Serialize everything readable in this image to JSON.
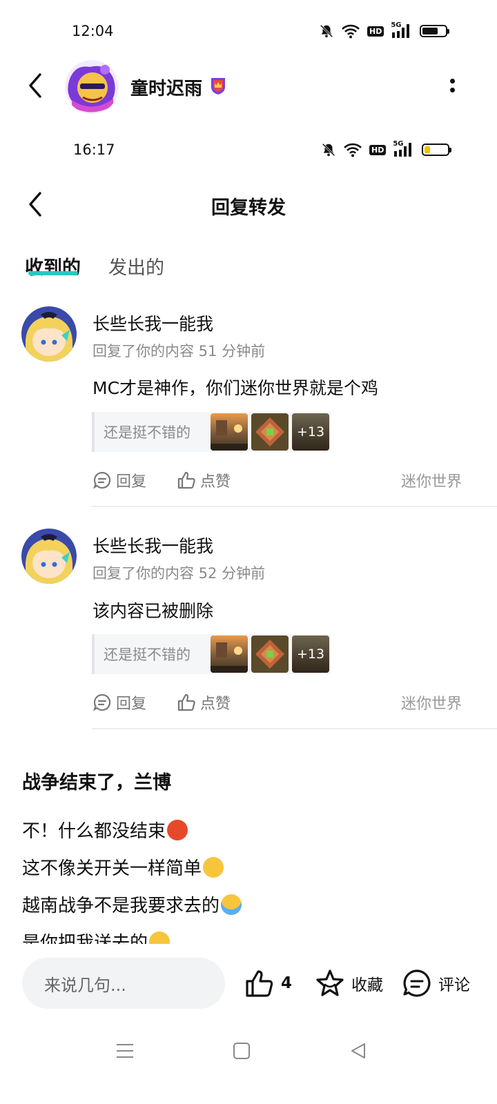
{
  "status_bar_1": {
    "time": "12:04",
    "hd": "HD",
    "network": "5G"
  },
  "profile_header": {
    "username": "童时迟雨"
  },
  "status_bar_2": {
    "time": "16:17",
    "hd": "HD",
    "network": "5G"
  },
  "page": {
    "title": "回复转发"
  },
  "tabs": [
    {
      "label": "收到的",
      "active": true
    },
    {
      "label": "发出的",
      "active": false
    }
  ],
  "items": [
    {
      "name": "长些长我一能我",
      "meta": "回复了你的内容 51 分钟前",
      "text": "MC才是神作，你们迷你世界就是个鸡",
      "quote_text": "还是挺不错的",
      "thumb_more": "+13",
      "reply_label": "回复",
      "like_label": "点赞",
      "source": "迷你世界"
    },
    {
      "name": "长些长我一能我",
      "meta": "回复了你的内容 52 分钟前",
      "text": "该内容已被删除",
      "quote_text": "还是挺不错的",
      "thumb_more": "+13",
      "reply_label": "回复",
      "like_label": "点赞",
      "source": "迷你世界"
    }
  ],
  "post": {
    "title": "战争结束了，兰博",
    "lines": [
      {
        "text": "不！什么都没结束",
        "emoji": "angry-face"
      },
      {
        "text": "这不像关开关一样简单",
        "emoji": "thinking-face"
      },
      {
        "text": "越南战争不是我要求去的",
        "emoji": "crying-face"
      },
      {
        "text": "是你把我送去的",
        "emoji": "sweat-smile-face"
      }
    ]
  },
  "bottom_bar": {
    "input_placeholder": "来说几句...",
    "like_count": "4",
    "favorite_label": "收藏",
    "comment_label": "评论"
  },
  "colors": {
    "accent": "#28c7c3",
    "battery_low": "#f5c000",
    "text_gray": "#8a8a8a"
  },
  "icons": [
    "back-arrow-icon",
    "more-dots-icon",
    "reply-icon",
    "like-icon",
    "star-icon",
    "comment-icon",
    "menu-icon",
    "home-square-icon",
    "back-triangle-icon",
    "wifi-icon",
    "mute-bell-icon",
    "battery-icon"
  ]
}
